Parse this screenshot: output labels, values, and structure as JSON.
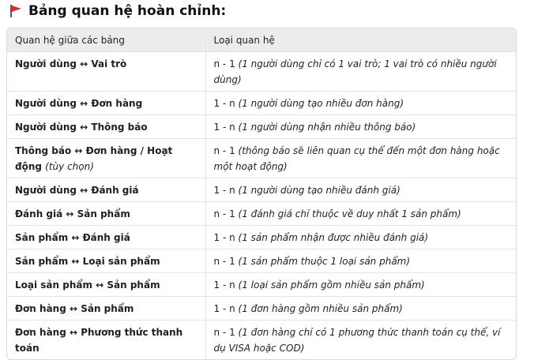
{
  "heading": "Bảng quan hệ hoàn chỉnh:",
  "icon": "red-flag-icon",
  "colors": {
    "flag": "#d32f2f",
    "header_bg": "#ececec",
    "border": "#e3e3e3"
  },
  "table": {
    "headers": [
      "Quan hệ giữa các bảng",
      "Loại quan hệ"
    ],
    "rows": [
      {
        "rel": "Người dùng ↔ Vai trò",
        "rel_note": "",
        "type": "n - 1",
        "type_note": "(1 người dùng chỉ có 1 vai trò; 1 vai trò có nhiều người dùng)"
      },
      {
        "rel": "Người dùng ↔ Đơn hàng",
        "rel_note": "",
        "type": "1 - n",
        "type_note": "(1 người dùng tạo nhiều đơn hàng)"
      },
      {
        "rel": "Người dùng ↔ Thông báo",
        "rel_note": "",
        "type": "1 - n",
        "type_note": "(1 người dùng nhận nhiều thông báo)"
      },
      {
        "rel": "Thông báo ↔ Đơn hàng / Hoạt động",
        "rel_note": "(tùy chọn)",
        "type": "n - 1",
        "type_note": "(thông báo sẽ liên quan cụ thể đến một đơn hàng hoặc một hoạt động)"
      },
      {
        "rel": "Người dùng ↔ Đánh giá",
        "rel_note": "",
        "type": "1 - n",
        "type_note": "(1 người dùng tạo nhiều đánh giá)"
      },
      {
        "rel": "Đánh giá ↔ Sản phẩm",
        "rel_note": "",
        "type": "n - 1",
        "type_note": "(1 đánh giá chỉ thuộc về duy nhất 1 sản phẩm)"
      },
      {
        "rel": "Sản phẩm ↔ Đánh giá",
        "rel_note": "",
        "type": "1 - n",
        "type_note": "(1 sản phẩm nhận được nhiều đánh giá)"
      },
      {
        "rel": "Sản phẩm ↔ Loại sản phẩm",
        "rel_note": "",
        "type": "n - 1",
        "type_note": "(1 sản phẩm thuộc 1 loại sản phẩm)"
      },
      {
        "rel": "Loại sản phẩm ↔ Sản phẩm",
        "rel_note": "",
        "type": "1 - n",
        "type_note": "(1 loại sản phẩm gồm nhiều sản phẩm)"
      },
      {
        "rel": "Đơn hàng ↔ Sản phẩm",
        "rel_note": "",
        "type": "1 - n",
        "type_note": "(1 đơn hàng gồm nhiều sản phẩm)"
      },
      {
        "rel": "Đơn hàng ↔ Phương thức thanh toán",
        "rel_note": "",
        "type": "n - 1",
        "type_note": "(1 đơn hàng chỉ có 1 phương thức thanh toán cụ thể, ví dụ VISA hoặc COD)"
      }
    ]
  }
}
